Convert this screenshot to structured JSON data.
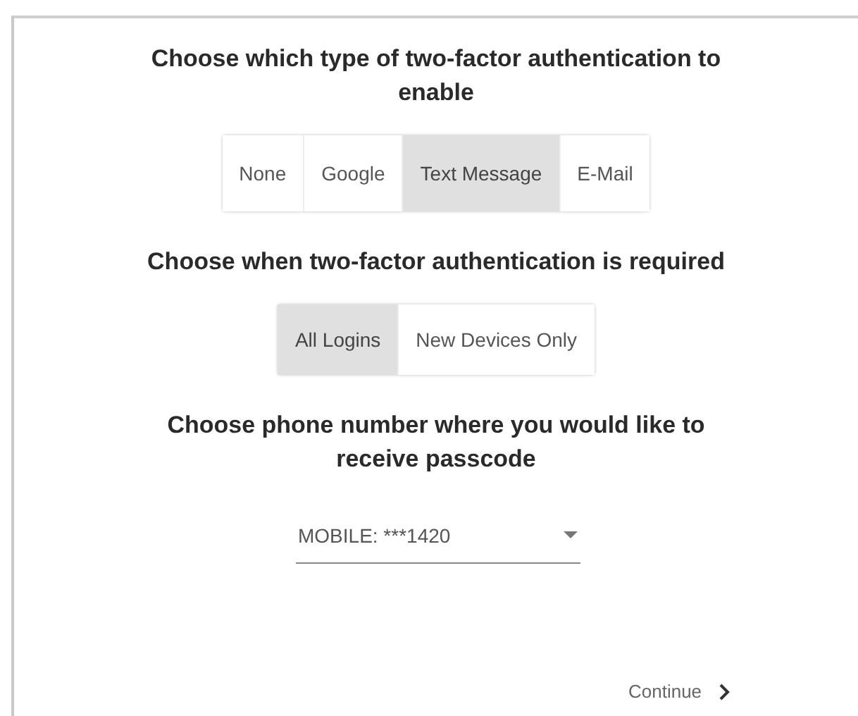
{
  "sections": [
    {
      "heading": "Choose which type of two-factor authentication to enable",
      "kind": "toggle",
      "options": [
        {
          "label": "None",
          "selected": false
        },
        {
          "label": "Google",
          "selected": false
        },
        {
          "label": "Text Message",
          "selected": true
        },
        {
          "label": "E-Mail",
          "selected": false
        }
      ]
    },
    {
      "heading": "Choose when two-factor authentication is required",
      "kind": "toggle",
      "options": [
        {
          "label": "All Logins",
          "selected": true
        },
        {
          "label": "New Devices Only",
          "selected": false
        }
      ]
    },
    {
      "heading": "Choose phone number where you would like to receive passcode",
      "kind": "select",
      "value": "MOBILE: ***1420"
    }
  ],
  "continue_button": {
    "label": "Continue"
  }
}
